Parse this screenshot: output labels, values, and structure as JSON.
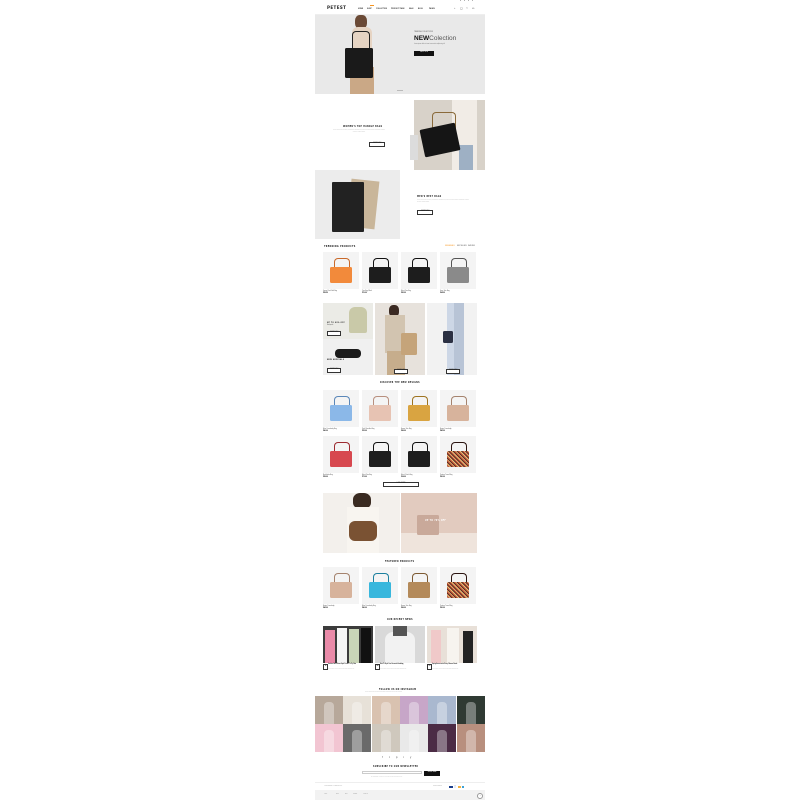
{
  "header": {
    "logo": "PETEST",
    "nav": [
      "HOME",
      "SHOP",
      "COLLECTION",
      "PRODUCT PAGE",
      "SALE",
      "BLOG",
      "PAGES"
    ],
    "new_badge": "NEW",
    "cart_count": "0"
  },
  "hero": {
    "eyebrow": "TRENDING COLLECTIONS",
    "title_bold": "NEW",
    "title_light": "Colection",
    "text": "Lorem ipsum dolor sit amet consectetur adipiscing elit",
    "button": "SHOP NOW"
  },
  "promo_women": {
    "title": "WOMEN'S TOP HANDLE BAGS",
    "text": "Lorem ipsum dolor sit amet, consectetur adipiscing elit, sed do eiusmod tempor incididunt ut labore et dolore magna aliqua.",
    "button": "SHOP NOW"
  },
  "promo_men": {
    "title": "MEN'S BEST BAGS",
    "text": "Lorem ipsum dolor sit amet, consectetur adipiscing elit, sed do eiusmod tempor incididunt ut labore et dolore magna aliqua.",
    "button": "SHOP NOW"
  },
  "trending": {
    "title": "TRENDING PRODUCTS",
    "tabs": [
      "NEW ARRIVALS",
      "BEST SELLERS",
      "FEATURED"
    ],
    "products": [
      {
        "name": "Fanny Pack Belt Bag",
        "price": "$58.00"
      },
      {
        "name": "Tote Bag Black",
        "price": "$76.00"
      },
      {
        "name": "Black Tote Bag",
        "price": "$82.00"
      },
      {
        "name": "Grey Tote Bag",
        "price": "$64.00"
      }
    ]
  },
  "banner_grid": {
    "sale1": "UP TO 40% OFF",
    "sale1_sub": "Backpacks",
    "sale2": "NEW ARRIVALS",
    "button": "SHOP NOW"
  },
  "new_designs": {
    "title": "DISCOVER THE NEW DESIGNS",
    "products": [
      {
        "name": "Blue Crossbody Bag",
        "price": "$40.00"
      },
      {
        "name": "Pink Shoulder Bag",
        "price": "$52.00"
      },
      {
        "name": "Brown Tote Bag",
        "price": "$68.00"
      },
      {
        "name": "Beige Crossbody",
        "price": "$46.00"
      },
      {
        "name": "Red Hobo Bag",
        "price": "$58.00"
      },
      {
        "name": "Black Tote Bag",
        "price": "$72.00"
      },
      {
        "name": "Black Clutch Bag",
        "price": "$34.00"
      },
      {
        "name": "Pattern Travel Bag",
        "price": "$90.00"
      }
    ],
    "load_more": "LOAD MORE"
  },
  "lookbook": {
    "overlay": "UP TO 70% OFF"
  },
  "featured": {
    "title": "FEATURED PRODUCTS",
    "products": [
      {
        "name": "Beige Crossbody",
        "price": "$46.00"
      },
      {
        "name": "Blue Crossbody Bag",
        "price": "$40.00"
      },
      {
        "name": "Brown Tote Bag",
        "price": "$68.00"
      },
      {
        "name": "Pattern Travel Bag",
        "price": "$90.00"
      }
    ]
  },
  "blog": {
    "title": "OUR RECENT NEWS",
    "posts": [
      {
        "day": "12",
        "title": "Fashion Week Street Style Trends To Try Now",
        "text": "Lorem ipsum dolor sit amet consectetur adipiscing elit."
      },
      {
        "day": "08",
        "title": "How To Style Your Favourite Handbag",
        "text": "Lorem ipsum dolor sit amet consectetur adipiscing elit."
      },
      {
        "day": "03",
        "title": "Spring Accessories Every Woman Needs",
        "text": "Lorem ipsum dolor sit amet consectetur adipiscing elit."
      }
    ]
  },
  "instagram": {
    "title": "FOLLOW US ON INSTAGRAM",
    "subtitle": "Lorem ipsum dolor sit amet consectetur adipiscing elit sed do eiusmod"
  },
  "social": [
    "f",
    "t",
    "p",
    "i",
    "y"
  ],
  "newsletter": {
    "title": "SUBSCRIBE TO OUR NEWSLETTER",
    "placeholder": "Your email address",
    "button": "SUBSCRIBE",
    "note": "By subscribing you agree to our Terms of Use and Privacy Policy"
  },
  "footer": {
    "copyright": "© Copyright 2024. All rights reserved.",
    "payment_label": "Payment methods",
    "payments": [
      "VISA",
      "PP",
      "MC",
      "AE"
    ],
    "links": [
      "Home",
      "Shop",
      "Blog",
      "Contact",
      "About Us"
    ],
    "colors": {
      "accent": "#f7941d",
      "dark": "#111111",
      "light": "#f2f2f2"
    }
  }
}
